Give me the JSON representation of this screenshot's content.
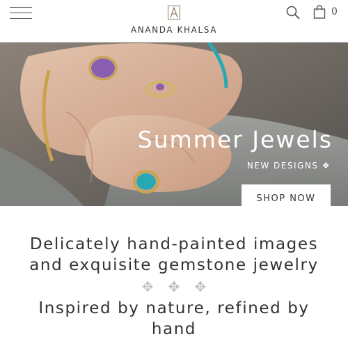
{
  "header": {
    "brand": "ANANDA KHALSA",
    "menu_icon": "hamburger-icon",
    "search_icon": "search-icon",
    "cart_icon": "shopping-bag-icon",
    "cart_count": "0"
  },
  "hero": {
    "title": "Summer Jewels",
    "subtitle": "NEW DESIGNS ❖",
    "cta_label": "SHOP NOW"
  },
  "intro": {
    "heading": "Delicately hand-painted images and exquisite gemstone jewelry",
    "ornament": [
      "✥",
      "✥",
      "✥"
    ],
    "subheading": "Inspired by nature, refined by hand"
  },
  "colors": {
    "text": "#333333",
    "ornament": "#bfbfbf",
    "header_border": "#e6e6e6"
  }
}
